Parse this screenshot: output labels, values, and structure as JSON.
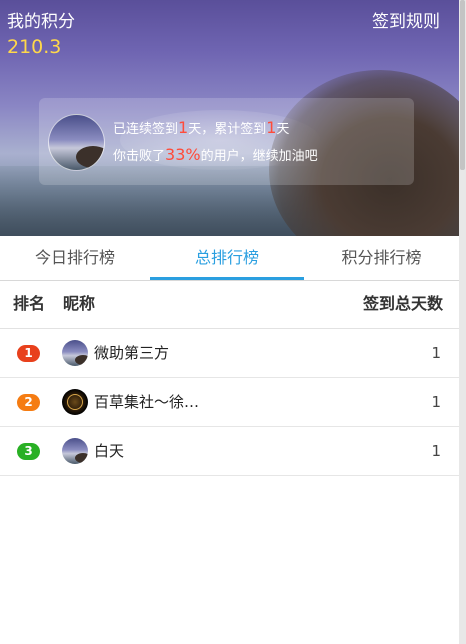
{
  "header": {
    "title": "我的积分",
    "rules_label": "签到规则",
    "points": "210.3"
  },
  "sign_card": {
    "line1_prefix": "已连续签到",
    "consecutive_days": "1",
    "line1_mid": "天，累计签到",
    "total_days": "1",
    "line1_suffix": "天",
    "line2_prefix": "你击败了",
    "beat_percent": "33%",
    "line2_suffix": "的用户，继续加油吧"
  },
  "tabs": [
    {
      "label": "今日排行榜",
      "active": false
    },
    {
      "label": "总排行榜",
      "active": true
    },
    {
      "label": "积分排行榜",
      "active": false
    }
  ],
  "table": {
    "columns": [
      "排名",
      "昵称",
      "签到总天数"
    ],
    "rows": [
      {
        "rank": "1",
        "name": "微助第三方",
        "days": "1",
        "badge_color": "#e8401c"
      },
      {
        "rank": "2",
        "name": "百草集社～徐…",
        "days": "1",
        "badge_color": "#f57c12"
      },
      {
        "rank": "3",
        "name": "白天",
        "days": "1",
        "badge_color": "#29b024"
      }
    ]
  },
  "colors": {
    "accent": "#2a9fe0",
    "points": "#ffd84a",
    "highlight": "#ff4b3a"
  }
}
